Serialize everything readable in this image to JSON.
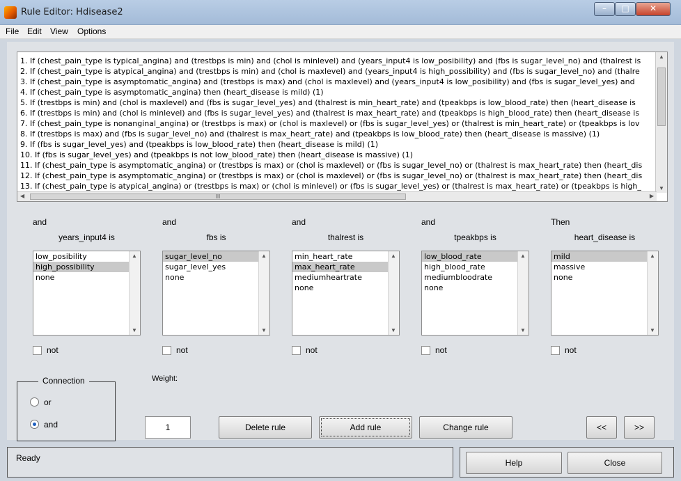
{
  "window": {
    "title": "Rule Editor: Hdisease2",
    "minimize": "–",
    "maximize": "□",
    "close": "✕"
  },
  "menu": [
    "File",
    "Edit",
    "View",
    "Options"
  ],
  "rules": [
    "1. If (chest_pain_type is typical_angina) and (trestbps is min) and (chol is minlevel) and (years_input4 is low_posibility) and (fbs is sugar_level_no) and (thalrest is",
    "2. If (chest_pain_type is atypical_angina) and (trestbps is min) and (chol is maxlevel) and (years_input4 is high_possibility) and (fbs is sugar_level_no) and (thalre",
    "3. If (chest_pain_type is asymptomatic_angina) and (trestbps is max) and (chol is maxlevel) and (years_input4 is low_posibility) and (fbs is sugar_level_yes) and",
    "4. If (chest_pain_type is asymptomatic_angina) then (heart_disease is mild) (1)",
    "5. If (trestbps is min) and (chol is maxlevel) and (fbs is sugar_level_yes) and (thalrest is min_heart_rate) and (tpeakbps is low_blood_rate) then (heart_disease is",
    "6. If (trestbps is min) and (chol is minlevel) and (fbs is sugar_level_yes) and (thalrest is max_heart_rate) and (tpeakbps is high_blood_rate) then (heart_disease is",
    "7. If (chest_pain_type is nonanginal_angina) or (trestbps is max) or (chol is maxlevel) or (fbs is sugar_level_yes) or (thalrest is min_heart_rate) or (tpeakbps is lov",
    "8. If (trestbps is max) and (fbs is sugar_level_no) and (thalrest is max_heart_rate) and (tpeakbps is low_blood_rate) then (heart_disease is massive) (1)",
    "9. If (fbs is sugar_level_yes) and (tpeakbps is low_blood_rate) then (heart_disease is mild) (1)",
    "10. If (fbs is sugar_level_yes) and (tpeakbps is not low_blood_rate) then (heart_disease is massive) (1)",
    "11. If (chest_pain_type is asymptomatic_angina) or (trestbps is max) or (chol is maxlevel) or (fbs is sugar_level_no) or (thalrest is max_heart_rate) then (heart_dis",
    "12. If (chest_pain_type is asymptomatic_angina) or (trestbps is max) or (chol is maxlevel) or (fbs is sugar_level_no) or (thalrest is max_heart_rate) then (heart_dis",
    "13. If (chest_pain_type is atypical_angina) or (trestbps is max) or (chol is minlevel) or (fbs is sugar_level_yes) or (thalrest is max_heart_rate) or (tpeakbps is high_"
  ],
  "hscroll_glyph": "III",
  "variables": [
    {
      "connector": "and",
      "header": "years_input4 is",
      "items": [
        "low_posibility",
        "high_possibility",
        "none"
      ],
      "selected": 1,
      "not_label": "not"
    },
    {
      "connector": "and",
      "header": "fbs is",
      "items": [
        "sugar_level_no",
        "sugar_level_yes",
        "none"
      ],
      "selected": 0,
      "not_label": "not"
    },
    {
      "connector": "and",
      "header": "thalrest is",
      "items": [
        "min_heart_rate",
        "max_heart_rate",
        "mediumheartrate",
        "none"
      ],
      "selected": 1,
      "not_label": "not"
    },
    {
      "connector": "and",
      "header": "tpeakbps is",
      "items": [
        "low_blood_rate",
        "high_blood_rate",
        "mediumbloodrate",
        "none"
      ],
      "selected": 0,
      "not_label": "not"
    },
    {
      "connector": "Then",
      "header": "heart_disease is",
      "items": [
        "mild",
        "massive",
        "none"
      ],
      "selected": 0,
      "not_label": "not"
    }
  ],
  "connection": {
    "title": "Connection",
    "options": [
      "or",
      "and"
    ],
    "selected": "and"
  },
  "weight": {
    "label": "Weight:",
    "value": "1"
  },
  "buttons": {
    "delete_rule": "Delete rule",
    "add_rule": "Add rule",
    "change_rule": "Change rule",
    "prev": "<<",
    "next": ">>",
    "help": "Help",
    "close": "Close"
  },
  "status": "Ready"
}
